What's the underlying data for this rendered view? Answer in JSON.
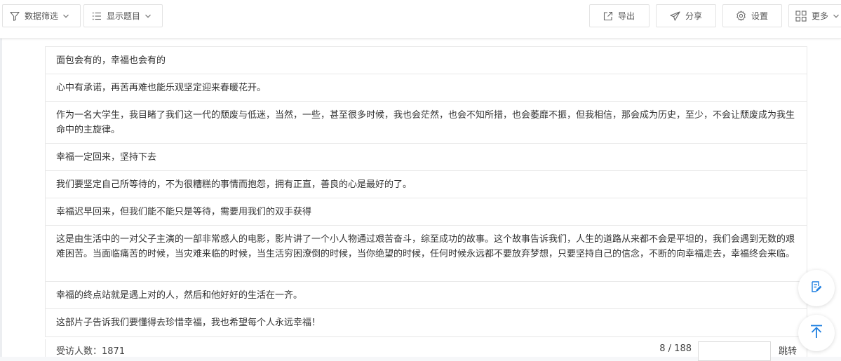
{
  "toolbar": {
    "filter_label": "数据筛选",
    "columns_label": "显示题目",
    "export_label": "导出",
    "share_label": "分享",
    "settings_label": "设置",
    "more_label": "更多"
  },
  "answers": [
    "面包会有的，幸福也会有的",
    "心中有承诺，再苦再难也能乐观坚定迎来春暖花开。",
    "作为一名大学生，我目睹了我们这一代的颓废与低迷，当然，一些，甚至很多时候，我也会茫然，也会不知所措，也会萎靡不振，但我相信，那会成为历史，至少，不会让颓废成为我生命中的主旋律。",
    "幸福一定回来，坚持下去",
    "我们要坚定自己所等待的，不为很糟糕的事情而抱怨，拥有正直，善良的心是最好的了。",
    "幸福迟早回来，但我们能不能只是等待，需要用我们的双手获得",
    "这是由生活中的一对父子主演的一部非常感人的电影，影片讲了一个小人物通过艰苦奋斗，综至成功的故事。这个故事告诉我们，人生的道路从来都不会是平坦的，我们会遇到无数的艰难困苦。当面临痛苦的时候，当灾难来临的时候，当生活穷困潦倒的时候，当你绝望的时候，任何时候永远都不要放弃梦想，只要坚持自己的信念，不断的向幸福走去，幸福终会来临。",
    "幸福的终点站就是遇上对的人，然后和他好好的生活在一齐。",
    "这部片子告诉我们要懂得去珍惜幸福，我也希望每个人永远幸福！"
  ],
  "footer": {
    "respondents_label": "受访人数：1871",
    "page_indicator": "8 / 188",
    "page_input_value": "",
    "jump_label": "跳转"
  },
  "colors": {
    "accent": "#1e7fe0",
    "border": "#e8e8e8",
    "text": "#333333"
  },
  "icons": {
    "filter": "funnel-icon",
    "columns": "list-icon",
    "export": "export-icon",
    "share": "send-icon",
    "settings": "gear-icon",
    "more": "grid-icon",
    "note": "note-edit-icon",
    "top": "arrow-up-icon"
  }
}
